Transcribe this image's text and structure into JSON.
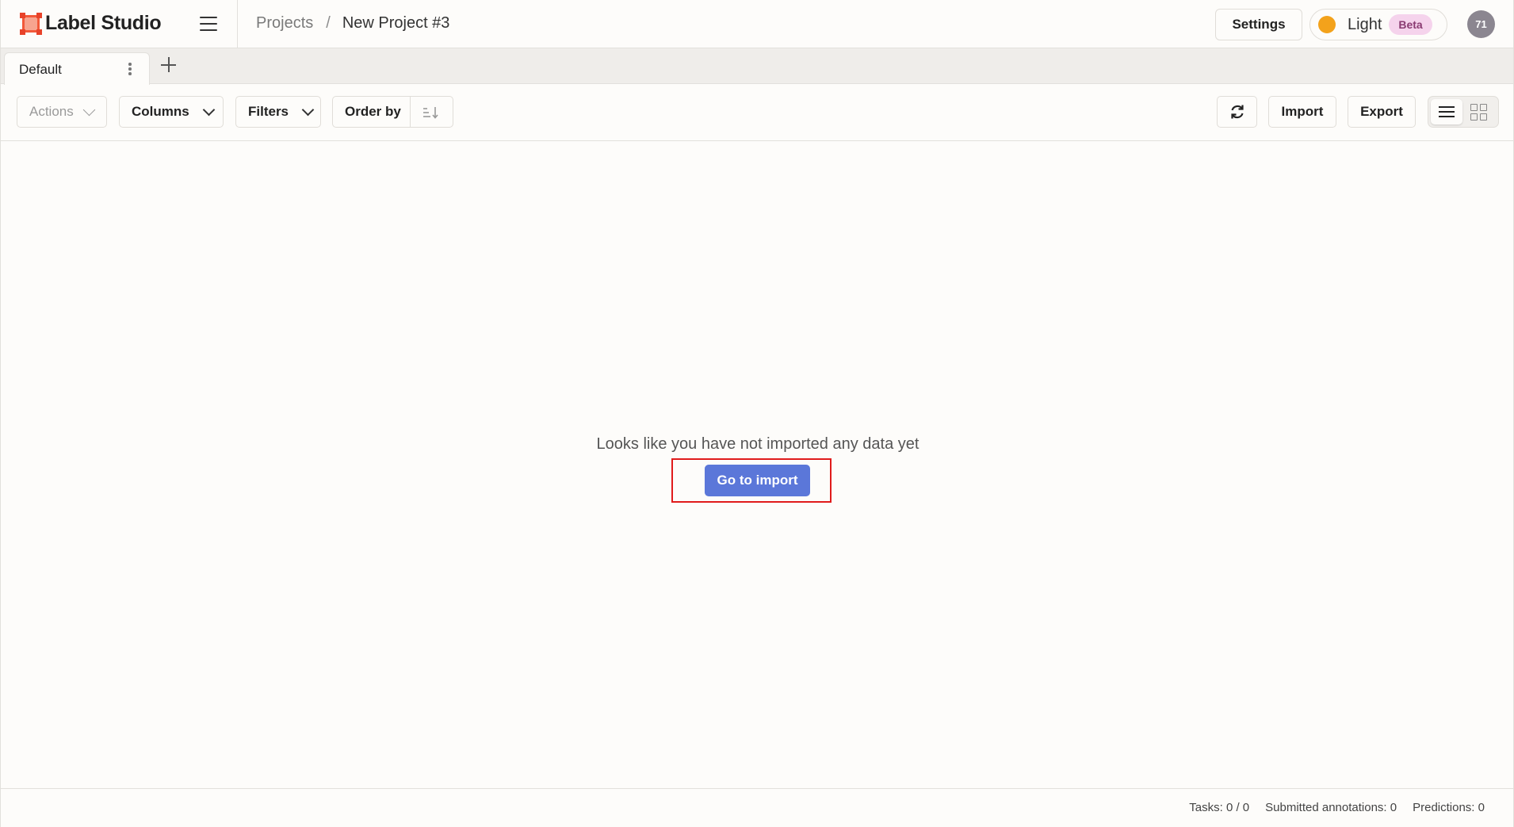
{
  "app": {
    "title": "Label Studio"
  },
  "header": {
    "breadcrumb": {
      "projects": "Projects",
      "separator": "/",
      "current": "New Project #3"
    },
    "settings_label": "Settings",
    "theme": {
      "label": "Light",
      "badge": "Beta"
    },
    "avatar_initials": "71"
  },
  "tabs": [
    {
      "label": "Default",
      "active": true
    }
  ],
  "toolbar": {
    "actions_label": "Actions",
    "columns_label": "Columns",
    "filters_label": "Filters",
    "order_by_label": "Order by",
    "import_label": "Import",
    "export_label": "Export",
    "view_mode": "list"
  },
  "empty_state": {
    "message": "Looks like you have not imported any data yet",
    "button_label": "Go to import"
  },
  "footer": {
    "tasks": "Tasks: 0 / 0",
    "submitted": "Submitted annotations: 0",
    "predictions": "Predictions: 0"
  },
  "colors": {
    "brand": "#f2593a",
    "primary_button": "#5b77d9",
    "highlight_outline": "#e01b1b",
    "beta_badge_bg": "#f5d3ec",
    "theme_indicator": "#f3a21b"
  }
}
